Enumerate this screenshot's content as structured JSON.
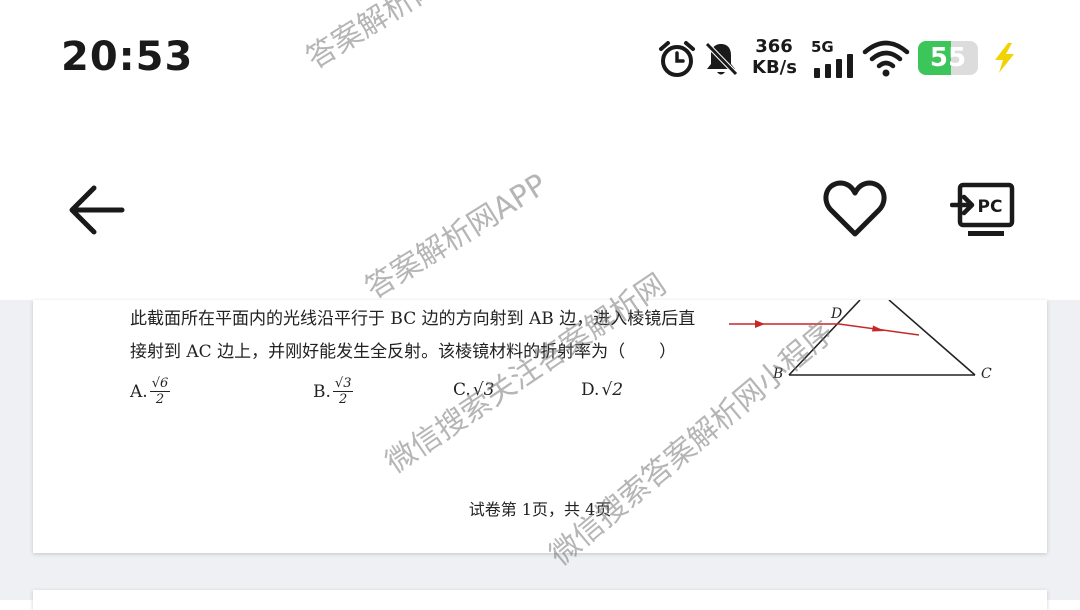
{
  "status_bar": {
    "time": "20:53",
    "speed_value": "366",
    "speed_unit": "KB/s",
    "network": "5G",
    "battery": "55",
    "battery_level": 0.55,
    "icons": [
      "alarm-icon",
      "mute-bell-icon",
      "signal-icon",
      "wifi-icon",
      "battery-icon",
      "charging-icon"
    ]
  },
  "header": {
    "icons": [
      "back-arrow-icon",
      "heart-icon",
      "pc-cast-icon"
    ],
    "pc_label": "PC"
  },
  "document": {
    "line1": "此截面所在平面内的光线沿平行于 BC 边的方向射到 AB 边，进入棱镜后直",
    "line2": "接射到 AC 边上，并刚好能发生全反射。该棱镜材料的折射率为（　　）",
    "options": [
      {
        "label": "A.",
        "num": "√6",
        "den": "2"
      },
      {
        "label": "B.",
        "num": "√3",
        "den": "2"
      },
      {
        "label": "C.",
        "expr": "√3"
      },
      {
        "label": "D.",
        "expr": "√2"
      }
    ],
    "diagram_labels": {
      "d": "D",
      "b": "B",
      "c": "C"
    },
    "footer": "试卷第 1页，共 4页"
  },
  "watermarks": [
    "答案解析网",
    "答案解析网APP",
    "微信搜索关注答案解析网",
    "微信搜索答案解析网小程序",
    "答案解析网"
  ],
  "colors": {
    "accent_green": "#3cc65a",
    "charge_yellow": "#f2d200",
    "ray_red": "#c62828"
  }
}
